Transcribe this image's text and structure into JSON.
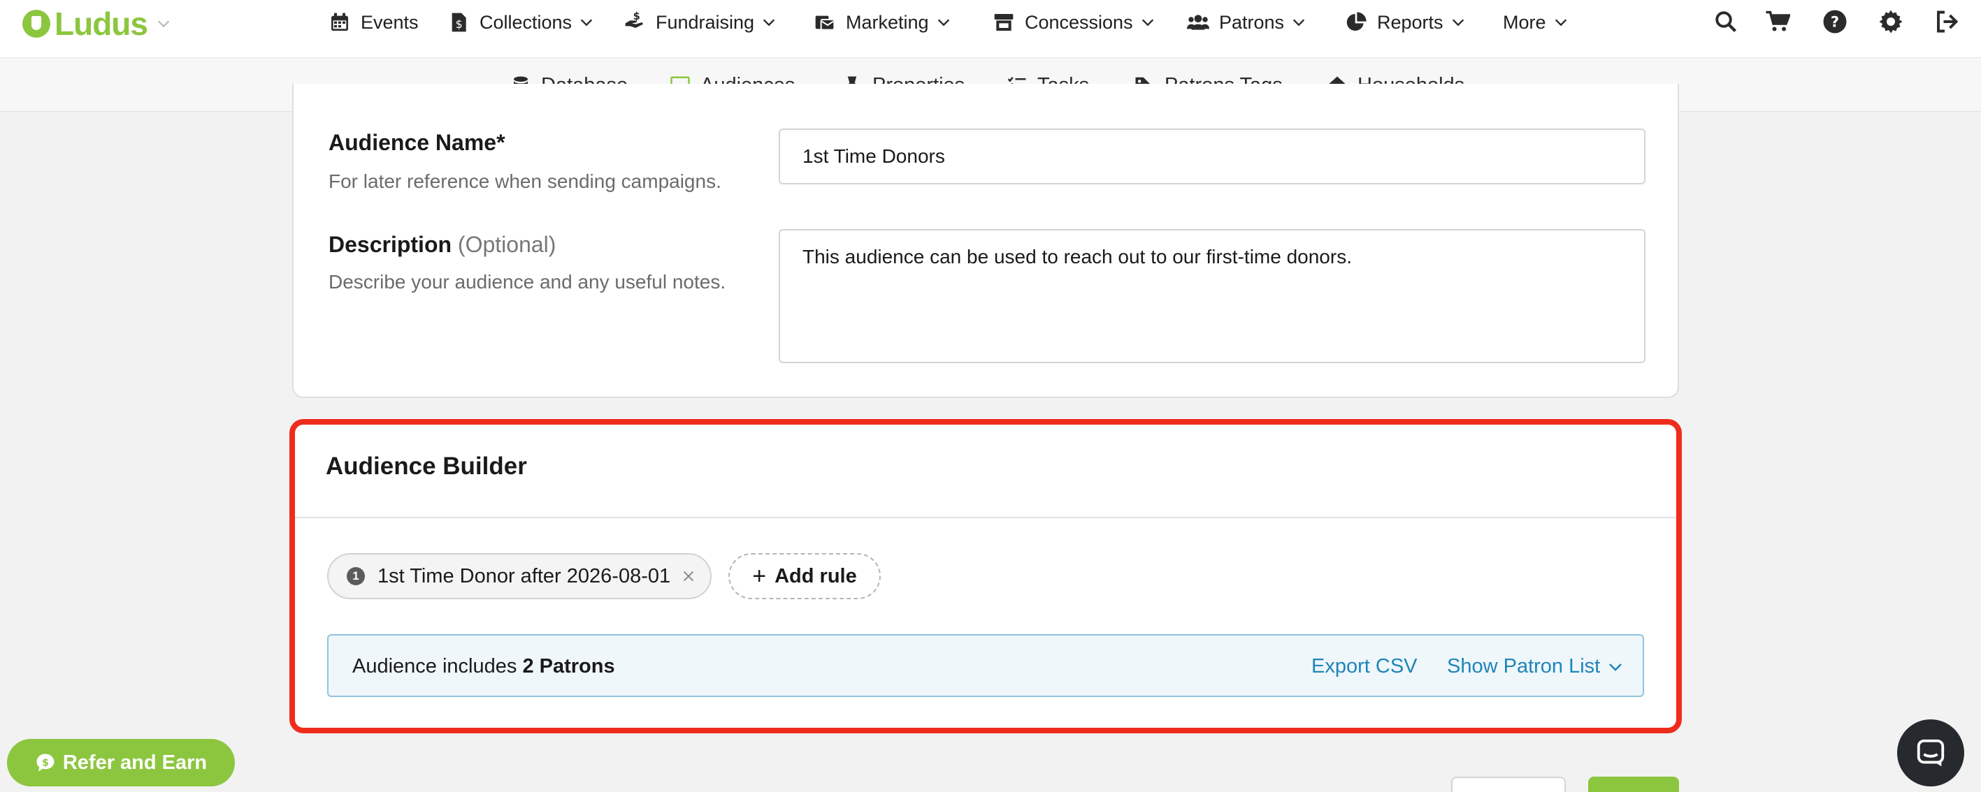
{
  "brand": {
    "name": "Ludus",
    "color": "#8cc63f"
  },
  "nav": {
    "events": "Events",
    "collections": "Collections",
    "fundraising": "Fundraising",
    "marketing": "Marketing",
    "concessions": "Concessions",
    "patrons": "Patrons",
    "reports": "Reports",
    "more": "More"
  },
  "tools": [
    "search-icon",
    "cart-icon",
    "help-icon",
    "settings-icon",
    "logout-icon"
  ],
  "subnav": {
    "database": "Database",
    "audiences": "Audiences",
    "properties": "Properties",
    "tasks": "Tasks",
    "patron_tags": "Patrons Tags",
    "households": "Households",
    "active": "audiences"
  },
  "form": {
    "name_label": "Audience Name*",
    "name_help": "For later reference when sending campaigns.",
    "name_value": "1st Time Donors",
    "desc_label": "Description",
    "desc_optional": "(Optional)",
    "desc_help": "Describe your audience and any useful notes.",
    "desc_value": "This audience can be used to reach out to our first-time donors."
  },
  "builder": {
    "title": "Audience Builder",
    "rule_number": "1",
    "rule_label": "1st Time Donor after 2026-08-01",
    "add_rule": "Add rule",
    "summary_prefix": "Audience includes",
    "summary_count": "2 Patrons",
    "export_csv": "Export CSV",
    "show_patron_list": "Show Patron List",
    "highlight_color": "#ef2c1c"
  },
  "refer": {
    "label": "Refer and Earn"
  }
}
